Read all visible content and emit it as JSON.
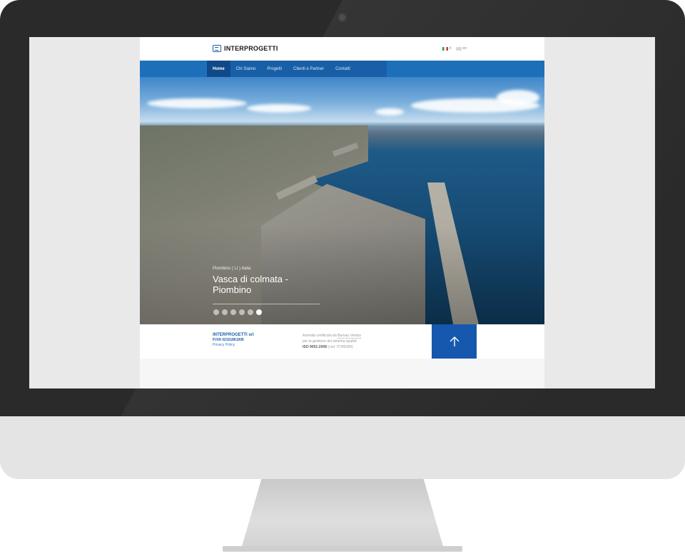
{
  "header": {
    "logo_text": "INTERPROGETTI",
    "languages": [
      {
        "code": "it",
        "label": "it"
      },
      {
        "code": "en",
        "label": "en"
      }
    ]
  },
  "nav": {
    "items": [
      {
        "label": "Home",
        "active": true
      },
      {
        "label": "Chi Siamo",
        "active": false
      },
      {
        "label": "Progetti",
        "active": false
      },
      {
        "label": "Clienti e Partner",
        "active": false
      },
      {
        "label": "Contatti",
        "active": false
      }
    ]
  },
  "hero": {
    "location": "Piombino ( LI ) Italia",
    "title": "Vasca di colmata - Piombino",
    "slide_count": 6,
    "active_slide": 6
  },
  "footer": {
    "company_name": "INTERPROGETTI srl",
    "vat": "P.IVA 02161861006",
    "privacy": "Privacy Policy",
    "cert_line1_prefix": "Azienda certificata da ",
    "cert_link": "Bureau Veritas",
    "cert_line2": "per la gestione del sistema qualità",
    "cert_iso": "ISO 9001:2008",
    "cert_code": " (cod. IT249184)"
  },
  "colors": {
    "brand_blue": "#1d6fba",
    "nav_active": "#10498a",
    "up_button": "#1558ad"
  },
  "icons": {
    "up": "arrow-up-icon",
    "logo": "interprogetti-logo-icon"
  }
}
